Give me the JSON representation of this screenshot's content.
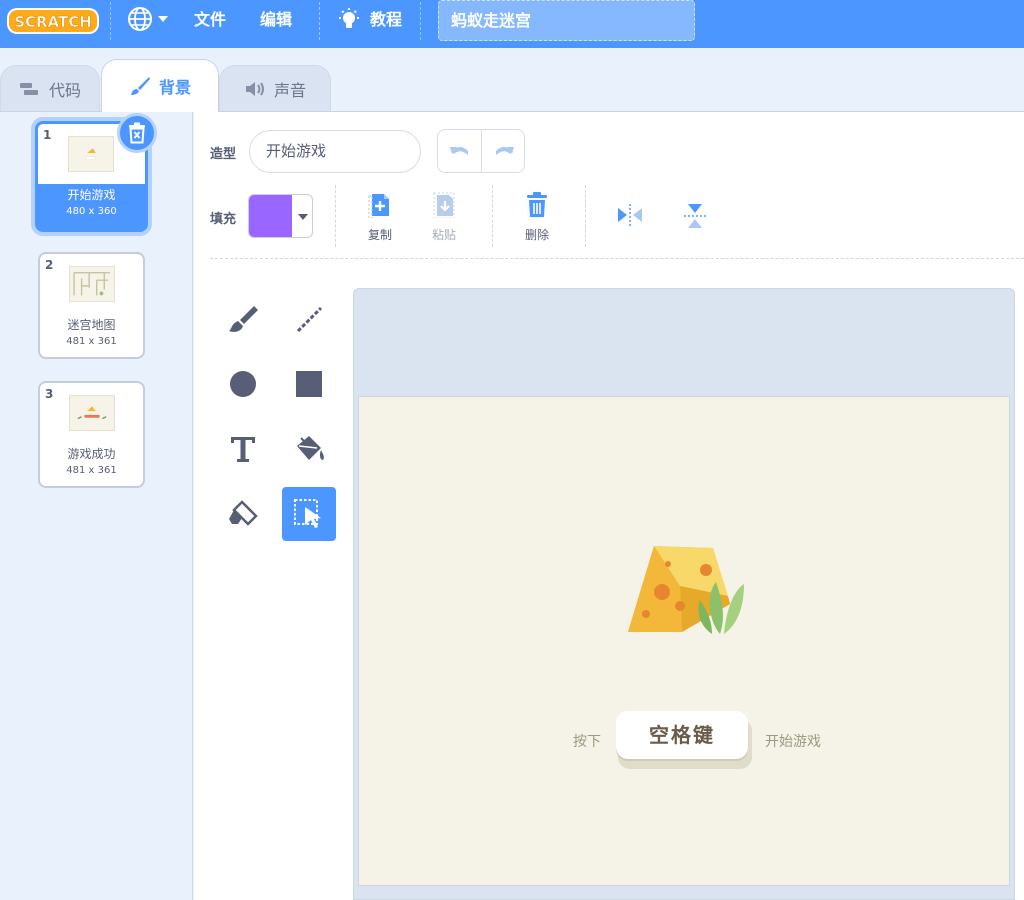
{
  "menubar": {
    "logo_text": "SCRATCH",
    "file": "文件",
    "edit": "编辑",
    "tutorials": "教程",
    "project_title": "蚂蚁走迷宫"
  },
  "tabs": [
    {
      "label": "代码",
      "active": false
    },
    {
      "label": "背景",
      "active": true
    },
    {
      "label": "声音",
      "active": false
    }
  ],
  "backdrops": [
    {
      "index": "1",
      "name": "开始游戏",
      "size": "480 x 360",
      "selected": true
    },
    {
      "index": "2",
      "name": "迷宫地图",
      "size": "481 x 361",
      "selected": false
    },
    {
      "index": "3",
      "name": "游戏成功",
      "size": "481 x 361",
      "selected": false
    }
  ],
  "editor": {
    "costume_label": "造型",
    "costume_name": "开始游戏",
    "fill_label": "填充",
    "fill_color": "#9966ff",
    "copy": "复制",
    "paste": "粘贴",
    "delete": "删除"
  },
  "tools": [
    "brush-icon",
    "line-icon",
    "circle-icon",
    "rectangle-icon",
    "text-icon",
    "fill-bucket-icon",
    "eraser-icon",
    "select-icon"
  ],
  "stage": {
    "press": "按下",
    "key": "空格键",
    "start": "开始游戏"
  },
  "colors": {
    "accent": "#4c97ff",
    "stage_bg": "#f5f3e8",
    "canvas_bg": "#dae3f0"
  }
}
